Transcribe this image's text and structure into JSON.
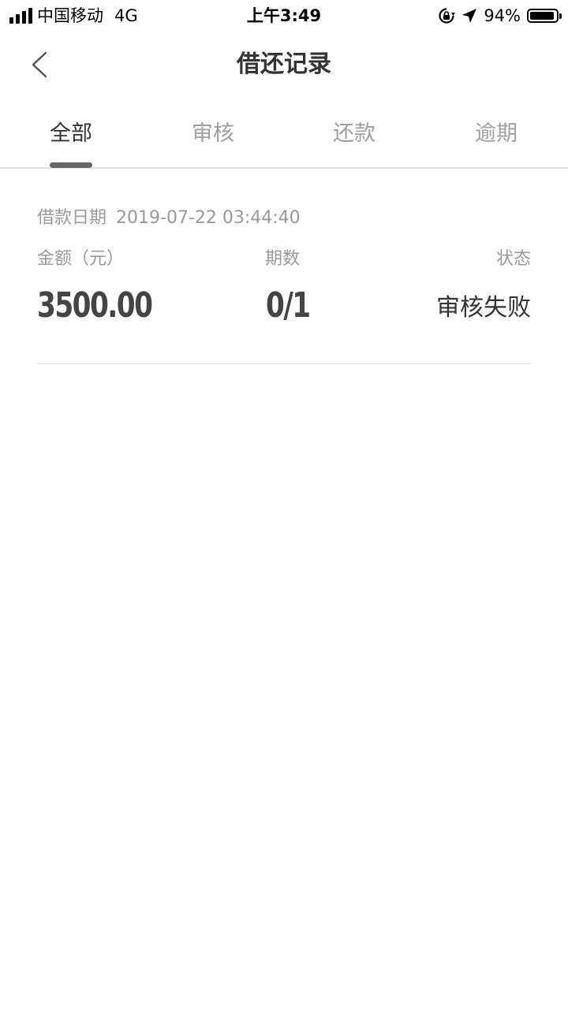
{
  "status_bar": {
    "carrier": "中国移动",
    "network": "4G",
    "time": "上午3:49",
    "battery_text": "94%",
    "battery_level": 0.94
  },
  "header": {
    "title": "借还记录",
    "back_icon": "chevron-left-icon"
  },
  "tabs": [
    {
      "label": "全部",
      "active": true
    },
    {
      "label": "审核",
      "active": false
    },
    {
      "label": "还款",
      "active": false
    },
    {
      "label": "逾期",
      "active": false
    }
  ],
  "records": [
    {
      "date_label": "借款日期",
      "date_value": "2019-07-22 03:44:40",
      "amount_label": "金额（元）",
      "amount": "3500.00",
      "periods_label": "期数",
      "periods": "0/1",
      "status_label": "状态",
      "status": "审核失败"
    }
  ],
  "colors": {
    "active_tab": "#333333",
    "inactive_tab": "#a0a0a0",
    "indicator": "#666666",
    "divider": "#e3e3e3"
  }
}
